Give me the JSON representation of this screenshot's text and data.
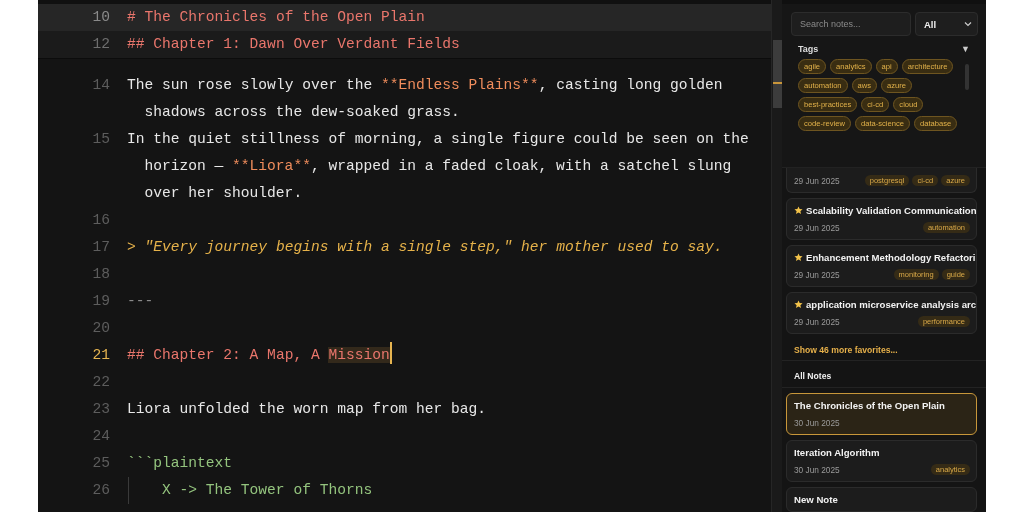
{
  "editor": {
    "sticky_lines": [
      {
        "number": "10",
        "current": true,
        "segments": [
          {
            "kind": "heading",
            "text": "# The Chronicles of the Open Plain"
          }
        ]
      },
      {
        "number": "12",
        "current": false,
        "segments": [
          {
            "kind": "heading",
            "text": "## Chapter 1: Dawn Over Verdant Fields"
          }
        ]
      }
    ],
    "lines": [
      {
        "number": "14",
        "kind": "text",
        "current": false,
        "segments": [
          {
            "kind": "text",
            "text": "The sun rose slowly over the "
          },
          {
            "kind": "bold",
            "text": "**Endless Plains**"
          },
          {
            "kind": "text",
            "text": ", casting long golden shadows across the dew-soaked grass."
          }
        ]
      },
      {
        "number": "15",
        "kind": "text",
        "current": false,
        "segments": [
          {
            "kind": "text",
            "text": "In the quiet stillness of morning, a single figure could be seen on the horizon — "
          },
          {
            "kind": "bold",
            "text": "**Liora**"
          },
          {
            "kind": "text",
            "text": ", wrapped in a faded cloak, with a satchel slung over her shoulder."
          }
        ]
      },
      {
        "number": "16",
        "kind": "text",
        "current": false
      },
      {
        "number": "17",
        "kind": "text",
        "current": false,
        "segments": [
          {
            "kind": "quote",
            "text": "> \"Every journey begins with a single step,\" her mother used to say."
          }
        ]
      },
      {
        "number": "18",
        "kind": "text",
        "current": false
      },
      {
        "number": "19",
        "kind": "text",
        "current": false,
        "segments": [
          {
            "kind": "rule",
            "text": "---"
          }
        ]
      },
      {
        "number": "20",
        "kind": "text",
        "current": false
      },
      {
        "number": "21",
        "kind": "text",
        "current": true,
        "segments": [
          {
            "kind": "heading",
            "text": "## Chapter 2: A Map, A "
          },
          {
            "kind": "match",
            "text": "Mission"
          }
        ]
      },
      {
        "number": "22",
        "kind": "text",
        "current": false
      },
      {
        "number": "23",
        "kind": "text",
        "current": false,
        "segments": [
          {
            "kind": "text",
            "text": "Liora unfolded the worn map from her bag."
          }
        ]
      },
      {
        "number": "24",
        "kind": "text",
        "current": false
      },
      {
        "number": "25",
        "kind": "text",
        "current": false,
        "segments": [
          {
            "kind": "code",
            "text": "```plaintext"
          }
        ]
      },
      {
        "number": "26",
        "kind": "code-block",
        "current": false,
        "segments": [
          {
            "kind": "code",
            "text": "X -> The Tower of Thorns"
          }
        ]
      }
    ]
  },
  "sidebar": {
    "search": {
      "placeholder": "Search notes..."
    },
    "filter": {
      "value": "All"
    },
    "tags_panel": {
      "title": "Tags",
      "toggle": "▼",
      "tags": [
        "agile",
        "analytics",
        "api",
        "architecture",
        "automation",
        "aws",
        "azure",
        "best-practices",
        "ci-cd",
        "cloud",
        "code-review",
        "data-science",
        "database"
      ]
    },
    "favorites": [
      {
        "date": "29 Jun 2025",
        "tags": [
          "postgresql",
          "ci-cd",
          "azure"
        ]
      },
      {
        "title": "Scalability Validation Communication",
        "date": "29 Jun 2025",
        "tags": [
          "automation"
        ],
        "starred": true
      },
      {
        "title": "Enhancement Methodology Refactori",
        "date": "29 Jun 2025",
        "tags": [
          "monitoring",
          "guide"
        ],
        "starred": true
      },
      {
        "title": "application microservice analysis arc",
        "date": "29 Jun 2025",
        "tags": [
          "performance"
        ],
        "starred": true
      }
    ],
    "show_more": "Show 46 more favorites...",
    "all_notes_title": "All Notes",
    "notes": [
      {
        "title": "The Chronicles of the Open Plain",
        "date": "30 Jun 2025",
        "selected": true
      },
      {
        "title": "Iteration Algorithm",
        "date": "30 Jun 2025",
        "tags": [
          "analytics"
        ],
        "selected": false
      },
      {
        "title": "New Note",
        "selected": false
      }
    ]
  }
}
